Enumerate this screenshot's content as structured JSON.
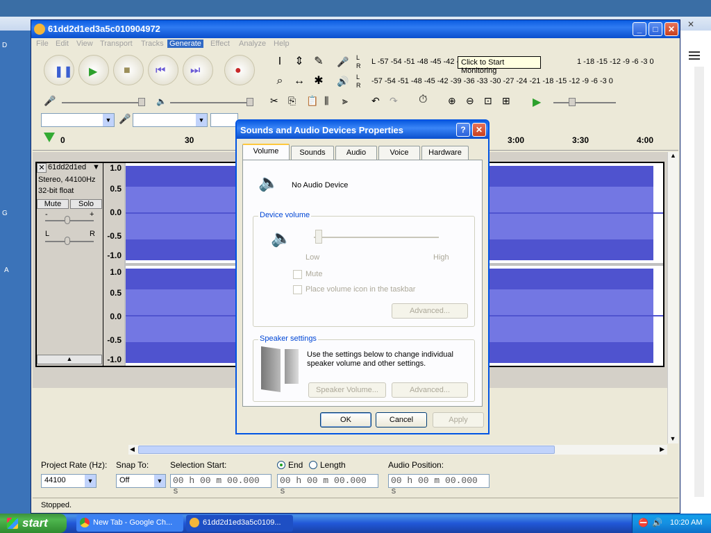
{
  "background_window": {
    "close_glyph": "✕",
    "left_edge_fragments": [
      "D",
      "G",
      "A"
    ]
  },
  "app": {
    "title": "61dd2d1ed3a5c010904972",
    "title_buttons": {
      "minimize": "_",
      "maximize": "□",
      "close": "✕"
    },
    "menu": [
      "File",
      "Edit",
      "View",
      "Transport",
      "Tracks",
      "Generate",
      "Effect",
      "Analyze",
      "Help"
    ],
    "active_menu": "Generate",
    "meter_scale_record": "L -57 -54 -51 -48 -45 -42 -3",
    "meter_scale_record_tail": "1 -18 -15 -12 -9 -6 -3 0",
    "meter_scale_play": "-57 -54 -51 -48 -45 -42 -39 -36 -33 -30 -27 -24 -21 -18 -15 -12 -9 -6 -3 0",
    "meter_tooltip": "Click to Start Monitoring",
    "ruler_ticks": [
      "0",
      "30",
      "3:00",
      "3:30",
      "4:00"
    ],
    "track": {
      "name": "61dd2d1ed",
      "line1": "Stereo, 44100Hz",
      "line2": "32-bit float",
      "mute": "Mute",
      "solo": "Solo",
      "gain_minus": "-",
      "gain_plus": "+",
      "pan_left": "L",
      "pan_right": "R",
      "scale": [
        "1.0",
        "0.5",
        "0.0",
        "-0.5",
        "-1.0"
      ]
    },
    "selection": {
      "project_rate_label": "Project Rate (Hz):",
      "project_rate_value": "44100",
      "snap_to_label": "Snap To:",
      "snap_to_value": "Off",
      "selection_start_label": "Selection Start:",
      "end_label": "End",
      "length_label": "Length",
      "audio_position_label": "Audio Position:",
      "start_time": "00 h 00 m 00.000 s",
      "end_time": "00 h 00 m 00.000 s",
      "audio_position": "00 h 00 m 00.000 s",
      "end_selected": true
    },
    "status": "Stopped."
  },
  "dialog": {
    "title": "Sounds and Audio Devices Properties",
    "help_btn": "?",
    "close_btn": "✕",
    "tabs": [
      "Volume",
      "Sounds",
      "Audio",
      "Voice",
      "Hardware"
    ],
    "selected_tab": "Volume",
    "device_name": "No Audio Device",
    "device_volume_label": "Device volume",
    "low": "Low",
    "high": "High",
    "mute": "Mute",
    "place_icon": "Place volume icon in the taskbar",
    "advanced": "Advanced...",
    "speaker_settings_label": "Speaker settings",
    "speaker_text": "Use the settings below to change individual speaker volume and other settings.",
    "speaker_volume": "Speaker Volume...",
    "advanced2": "Advanced...",
    "ok": "OK",
    "cancel": "Cancel",
    "apply": "Apply"
  },
  "taskbar": {
    "start": "start",
    "items": [
      {
        "label": "New Tab - Google Ch..."
      },
      {
        "label": "61dd2d1ed3a5c0109..."
      }
    ],
    "clock": "10:20 AM"
  },
  "colors": {
    "xp_blue": "#0a5be0",
    "waveform_outer": "#4f53cf",
    "waveform_inner": "#7377e3",
    "menu_highlight": "#316ac5"
  }
}
